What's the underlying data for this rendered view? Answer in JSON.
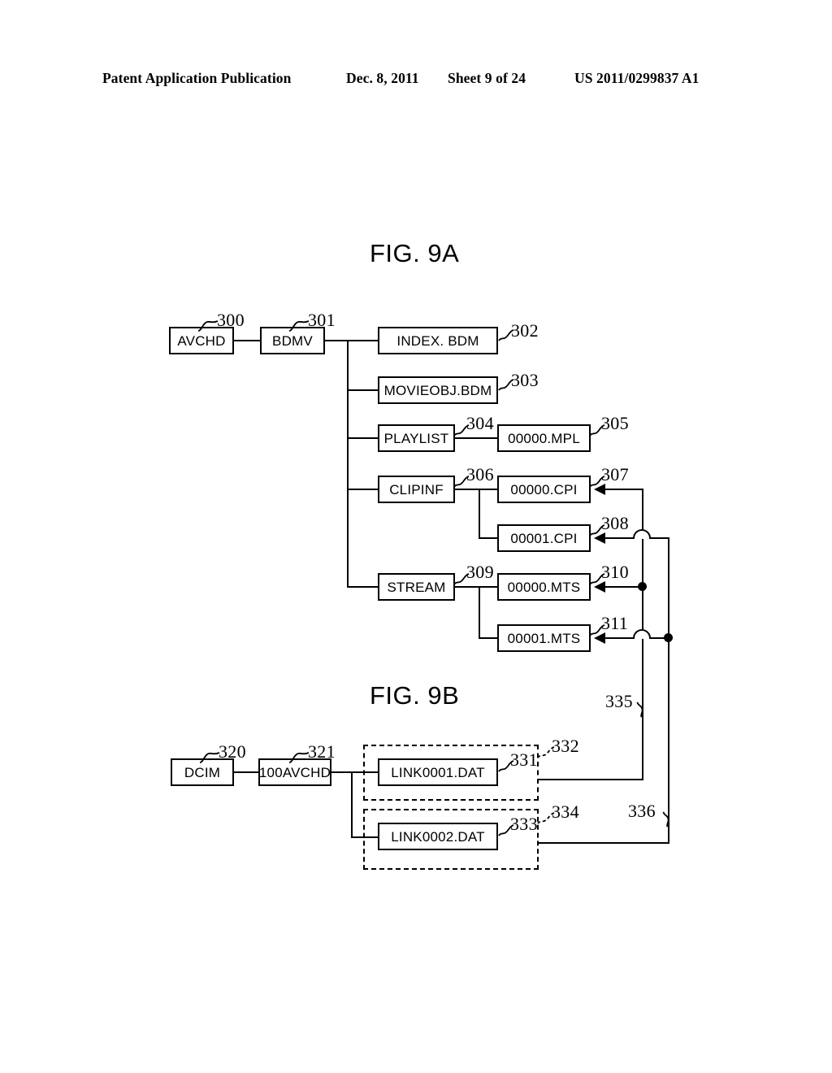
{
  "header": {
    "title": "Patent Application Publication",
    "date": "Dec. 8, 2011",
    "sheet": "Sheet 9 of 24",
    "publication_number": "US 2011/0299837 A1"
  },
  "figures": [
    {
      "title": "FIG. 9A",
      "description": "AVCHD directory structure tree on recording medium",
      "nodes": [
        {
          "ref": "300",
          "label": "AVCHD"
        },
        {
          "ref": "301",
          "label": "BDMV"
        },
        {
          "ref": "302",
          "label": "INDEX. BDM"
        },
        {
          "ref": "303",
          "label": "MOVIEOBJ.BDM"
        },
        {
          "ref": "304",
          "label": "PLAYLIST"
        },
        {
          "ref": "305",
          "label": "00000.MPL"
        },
        {
          "ref": "306",
          "label": "CLIPINF"
        },
        {
          "ref": "307",
          "label": "00000.CPI"
        },
        {
          "ref": "308",
          "label": "00001.CPI"
        },
        {
          "ref": "309",
          "label": "STREAM"
        },
        {
          "ref": "310",
          "label": "00000.MTS"
        },
        {
          "ref": "311",
          "label": "00001.MTS"
        }
      ]
    },
    {
      "title": "FIG. 9B",
      "description": "DCIM directory structure tree with link files",
      "nodes": [
        {
          "ref": "320",
          "label": "DCIM"
        },
        {
          "ref": "321",
          "label": "100AVCHD"
        },
        {
          "ref": "331",
          "label": "LINK0001.DAT"
        },
        {
          "ref": "333",
          "label": "LINK0002.DAT"
        }
      ],
      "groups": [
        {
          "ref": "332",
          "contains": "LINK0001.DAT"
        },
        {
          "ref": "334",
          "contains": "LINK0002.DAT"
        }
      ],
      "links": [
        {
          "ref": "335",
          "from": "332",
          "to": [
            "00000.CPI",
            "00000.MTS"
          ]
        },
        {
          "ref": "336",
          "from": "334",
          "to": [
            "00001.CPI",
            "00001.MTS"
          ]
        }
      ]
    }
  ],
  "reference_labels": {
    "n300": "300",
    "n301": "301",
    "n302": "302",
    "n303": "303",
    "n304": "304",
    "n305": "305",
    "n306": "306",
    "n307": "307",
    "n308": "308",
    "n309": "309",
    "n310": "310",
    "n311": "311",
    "n320": "320",
    "n321": "321",
    "n331": "331",
    "n332": "332",
    "n333": "333",
    "n334": "334",
    "n335": "335",
    "n336": "336"
  },
  "node_labels": {
    "avchd": "AVCHD",
    "bdmv": "BDMV",
    "index_bdm": "INDEX. BDM",
    "movieobj_bdm": "MOVIEOBJ.BDM",
    "playlist": "PLAYLIST",
    "mpl_00000": "00000.MPL",
    "clipinf": "CLIPINF",
    "cpi_00000": "00000.CPI",
    "cpi_00001": "00001.CPI",
    "stream": "STREAM",
    "mts_00000": "00000.MTS",
    "mts_00001": "00001.MTS",
    "dcim": "DCIM",
    "avchd_100": "100AVCHD",
    "link0001_dat": "LINK0001.DAT",
    "link0002_dat": "LINK0002.DAT"
  },
  "fig_titles": {
    "fig9a": "FIG. 9A",
    "fig9b": "FIG. 9B"
  },
  "colors": {
    "ink": "#000000",
    "paper": "#ffffff"
  }
}
